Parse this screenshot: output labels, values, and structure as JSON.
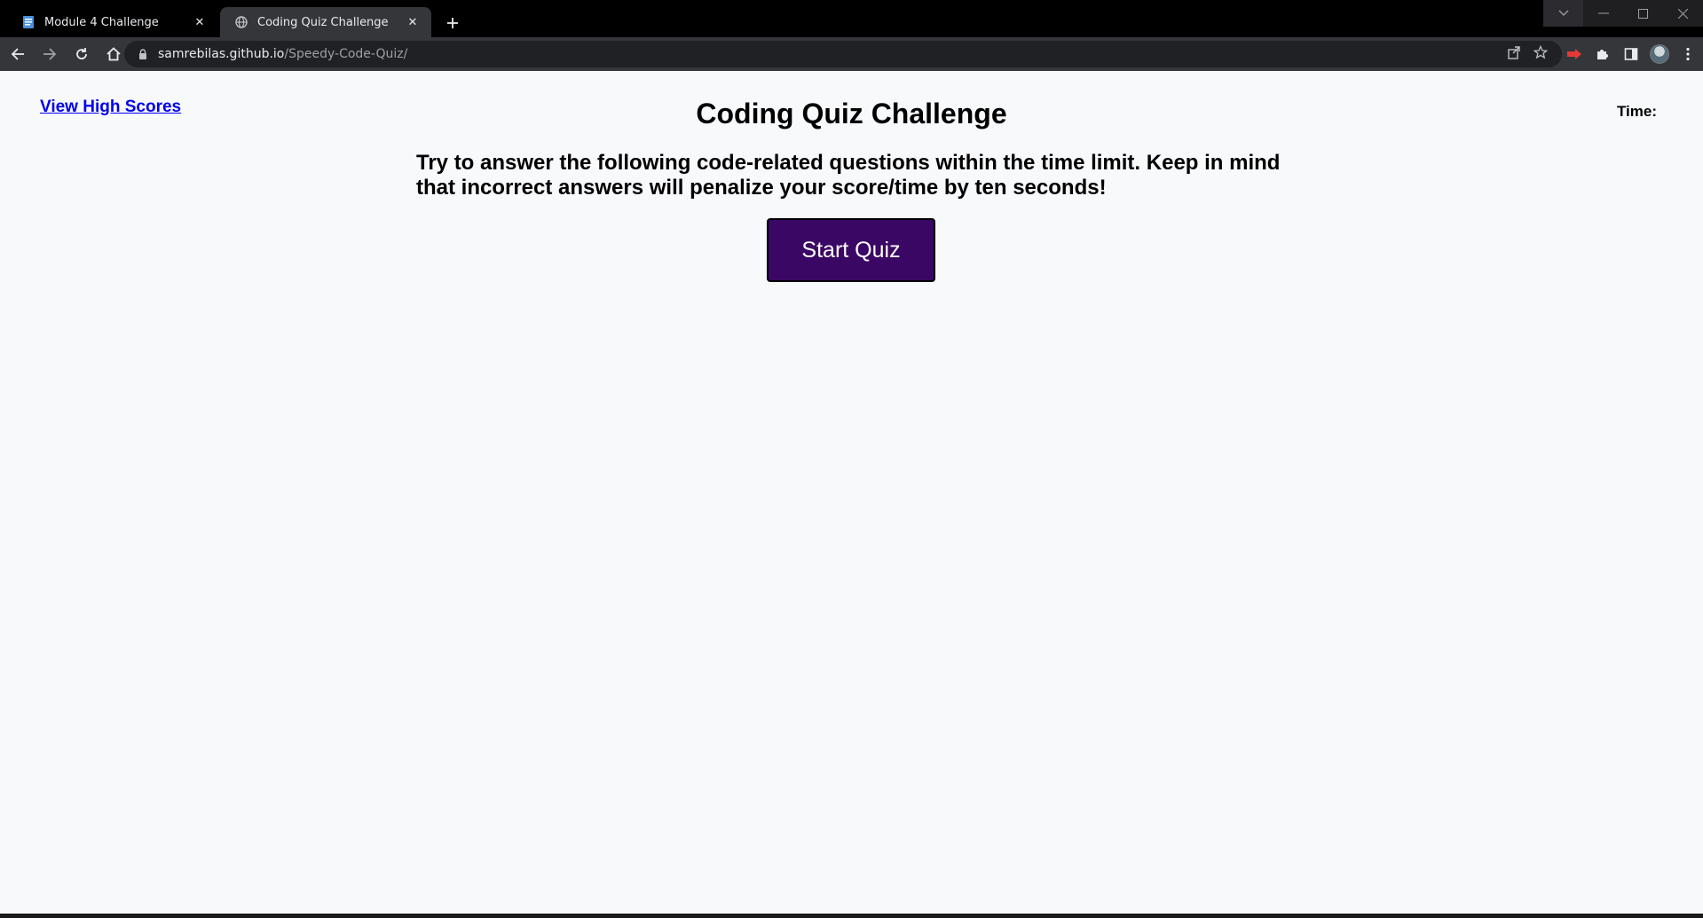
{
  "browser": {
    "tabs": [
      {
        "title": "Module 4 Challenge",
        "icon": "document-icon",
        "active": false
      },
      {
        "title": "Coding Quiz Challenge",
        "icon": "globe-icon",
        "active": true
      }
    ],
    "address": {
      "host": "samrebilas.github.io",
      "path": "/Speedy-Code-Quiz/"
    },
    "colors": {
      "frame": "#000000",
      "toolbar": "#35363a",
      "omnibox": "#202124"
    }
  },
  "page": {
    "high_scores_link": "View High Scores",
    "timer_label": "Time:",
    "timer_value": "",
    "title": "Coding Quiz Challenge",
    "intro": "Try to answer the following code-related questions within the time limit. Keep in mind that incorrect answers will penalize your score/time by ten seconds!",
    "start_button": "Start Quiz",
    "colors": {
      "background": "#f8f9fb",
      "button_bg": "#3b0764",
      "button_text": "#ffffff",
      "link": "#0000ee"
    }
  }
}
